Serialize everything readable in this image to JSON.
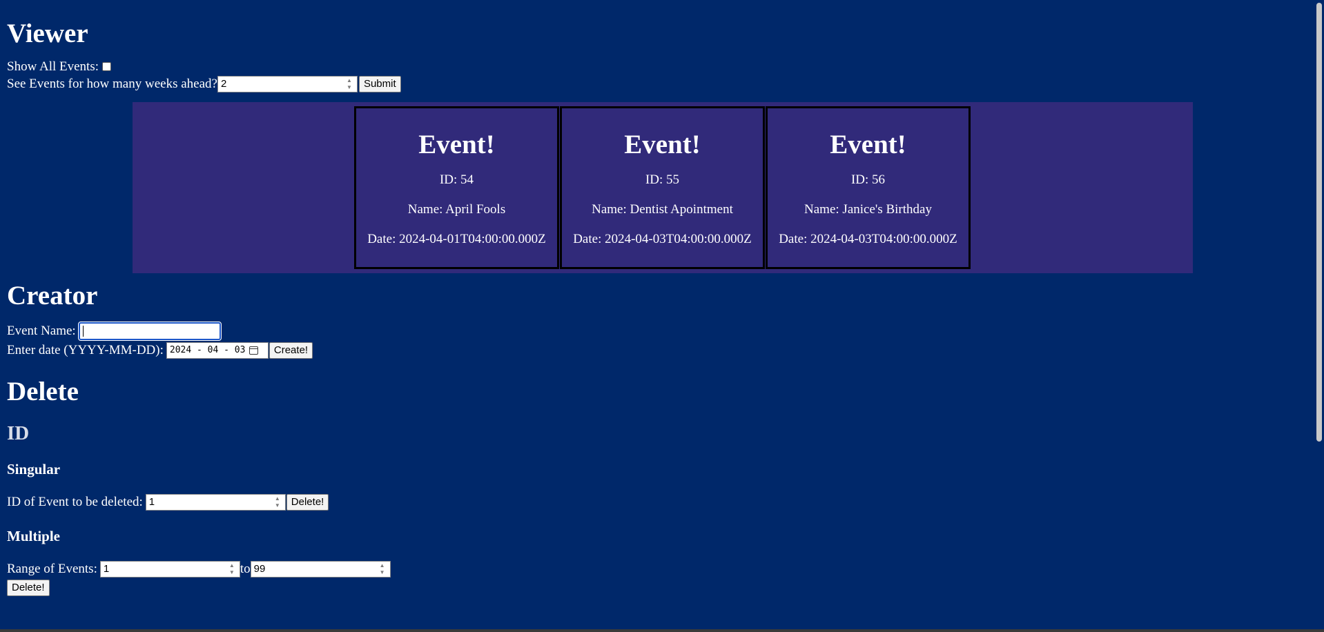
{
  "viewer": {
    "heading": "Viewer",
    "show_all_label": "Show All Events:",
    "weeks_label": "See Events for how many weeks ahead?",
    "weeks_value": "2",
    "submit_label": "Submit",
    "events": [
      {
        "title": "Event!",
        "id": "ID: 54",
        "name": "Name: April Fools",
        "date": "Date: 2024-04-01T04:00:00.000Z"
      },
      {
        "title": "Event!",
        "id": "ID: 55",
        "name": "Name: Dentist Apointment",
        "date": "Date: 2024-04-03T04:00:00.000Z"
      },
      {
        "title": "Event!",
        "id": "ID: 56",
        "name": "Name: Janice's Birthday",
        "date": "Date: 2024-04-03T04:00:00.000Z"
      }
    ]
  },
  "creator": {
    "heading": "Creator",
    "name_label": "Event Name:",
    "name_value": "",
    "date_label": "Enter date (YYYY-MM-DD):",
    "date_value": "2024 - 04 - 03",
    "create_label": "Create!"
  },
  "delete": {
    "heading": "Delete",
    "subheading": "ID",
    "singular": {
      "heading": "Singular",
      "label": "ID of Event to be deleted:",
      "value": "1",
      "button": "Delete!"
    },
    "multiple": {
      "heading": "Multiple",
      "label": "Range of Events:",
      "from_value": "1",
      "to_label": "to",
      "to_value": "99",
      "button": "Delete!"
    }
  },
  "colors": {
    "background": "#00286a",
    "events_panel": "#312a7a"
  }
}
